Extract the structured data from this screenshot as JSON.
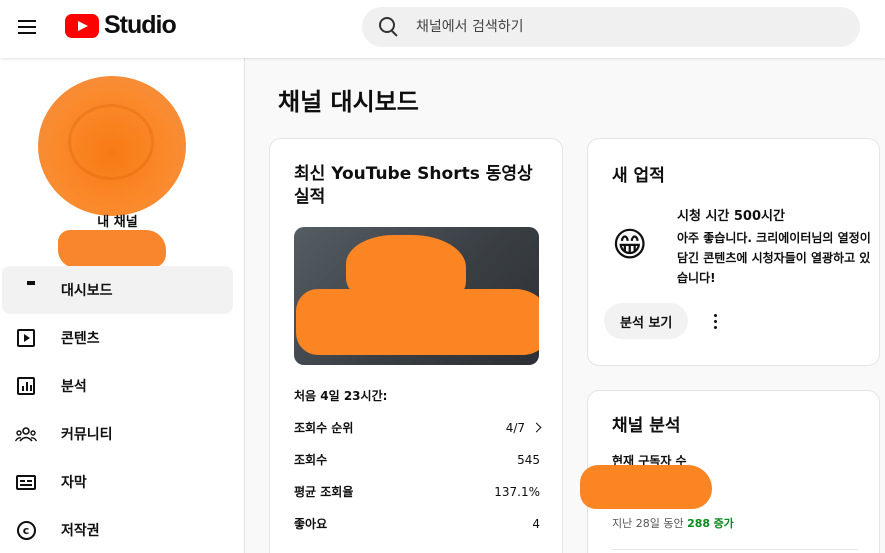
{
  "header": {
    "logo_text": "Studio",
    "search_placeholder": "채널에서 검색하기"
  },
  "sidebar": {
    "my_channel_label": "내 채널",
    "items": [
      {
        "label": "대시보드",
        "icon": "dashboard-icon",
        "active": true
      },
      {
        "label": "콘텐츠",
        "icon": "content-icon"
      },
      {
        "label": "분석",
        "icon": "analytics-icon"
      },
      {
        "label": "커뮤니티",
        "icon": "community-icon"
      },
      {
        "label": "자막",
        "icon": "subtitles-icon"
      },
      {
        "label": "저작권",
        "icon": "copyright-icon"
      }
    ]
  },
  "main": {
    "page_title": "채널 대시보드",
    "shorts_card": {
      "title": "최신 YouTube Shorts 동영상 실적",
      "first_days": "처음 4일 23시간:",
      "stats": [
        {
          "label": "조회수 순위",
          "value": "4/7"
        },
        {
          "label": "조회수",
          "value": "545"
        },
        {
          "label": "평균 조회율",
          "value": "137.1%"
        },
        {
          "label": "좋아요",
          "value": "4"
        }
      ]
    },
    "achievement_card": {
      "title": "새 업적",
      "emoji": "😁",
      "headline": "시청 시간 500시간",
      "body": "아주 좋습니다. 크리에이터님의 열정이 담긴 콘텐츠에 시청자들이 열광하고 있습니다!",
      "button_label": "분석 보기"
    },
    "analytics_card": {
      "title": "채널 분석",
      "subscribers_label": "현재 구독자 수",
      "trend_prefix": "지난 28일 동안",
      "trend_value": "288",
      "trend_suffix": "증가"
    }
  },
  "colors": {
    "brand_red": "#ff0000",
    "positive_green": "#0b8a1f",
    "redaction_orange": "#fb8423"
  }
}
